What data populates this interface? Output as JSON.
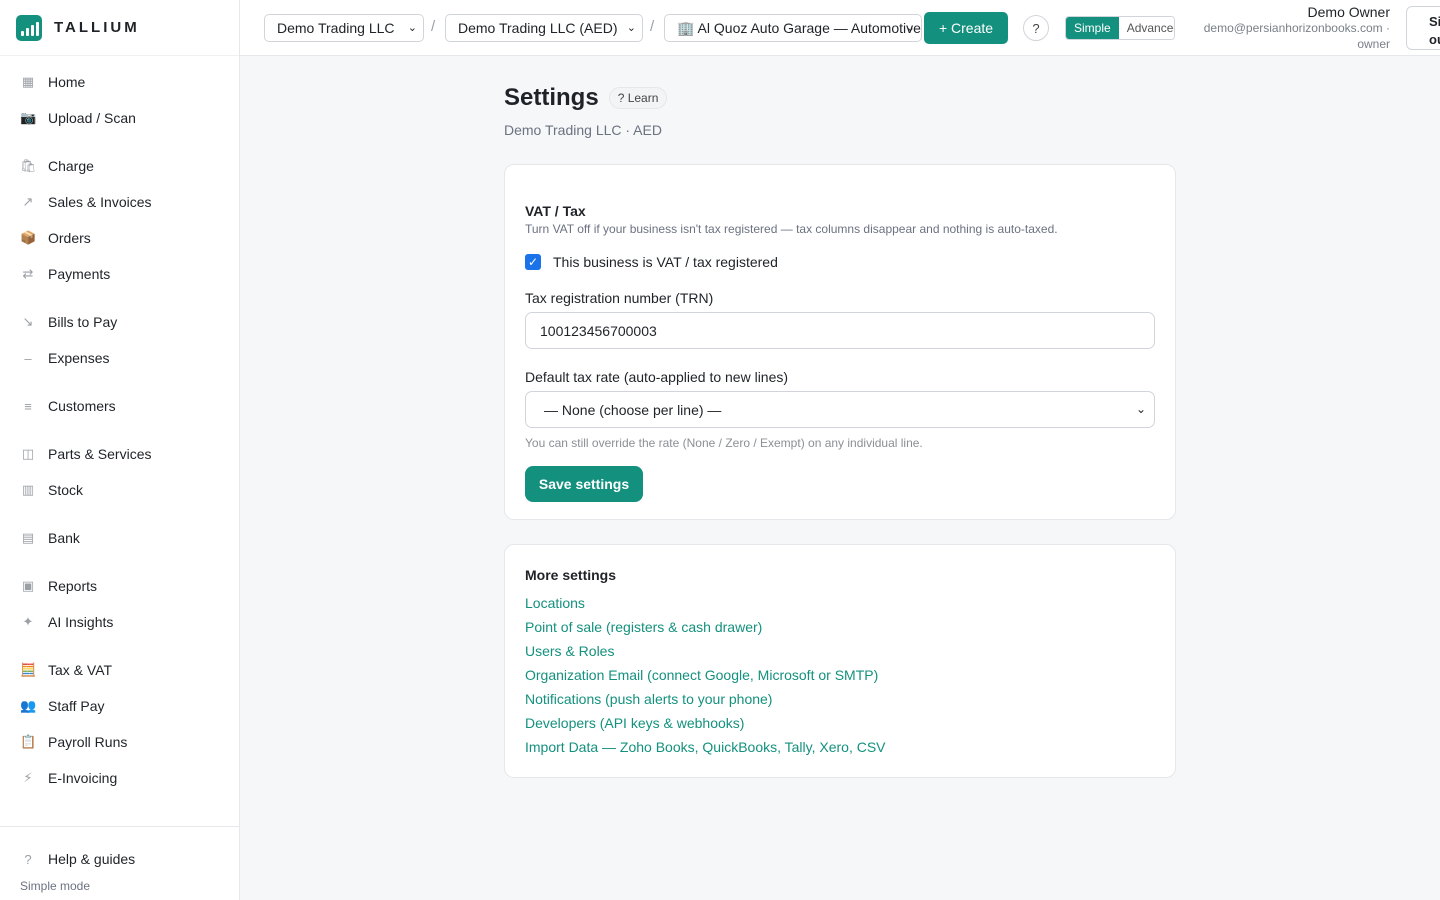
{
  "brand": {
    "name": "TALLIUM",
    "accent": "#14917e"
  },
  "sidebar": {
    "items": [
      {
        "label": "Home",
        "icon": "grid-icon",
        "glyph": "▦"
      },
      {
        "label": "Upload / Scan",
        "icon": "camera-icon",
        "glyph": "📷"
      },
      {
        "label": "Charge",
        "icon": "shopping-bag-icon",
        "glyph": "🛍"
      },
      {
        "label": "Sales & Invoices",
        "icon": "arrow-up-right-icon",
        "glyph": "↗"
      },
      {
        "label": "Orders",
        "icon": "package-icon",
        "glyph": "📦"
      },
      {
        "label": "Payments",
        "icon": "transfer-icon",
        "glyph": "⇄"
      },
      {
        "label": "Bills to Pay",
        "icon": "arrow-down-right-icon",
        "glyph": "↘"
      },
      {
        "label": "Expenses",
        "icon": "minus-icon",
        "glyph": "–"
      },
      {
        "label": "Customers",
        "icon": "list-icon",
        "glyph": "≡"
      },
      {
        "label": "Parts & Services",
        "icon": "box-icon",
        "glyph": "◫"
      },
      {
        "label": "Stock",
        "icon": "columns-icon",
        "glyph": "▥"
      },
      {
        "label": "Bank",
        "icon": "bank-icon",
        "glyph": "▤"
      },
      {
        "label": "Reports",
        "icon": "chart-icon",
        "glyph": "▣"
      },
      {
        "label": "AI Insights",
        "icon": "sparkle-icon",
        "glyph": "✦"
      },
      {
        "label": "Tax & VAT",
        "icon": "abacus-icon",
        "glyph": "🧮"
      },
      {
        "label": "Staff Pay",
        "icon": "people-icon",
        "glyph": "👥"
      },
      {
        "label": "Payroll Runs",
        "icon": "clipboard-icon",
        "glyph": "📋"
      },
      {
        "label": "E-Invoicing",
        "icon": "lightning-icon",
        "glyph": "⚡"
      }
    ],
    "help": {
      "label": "Help & guides",
      "glyph": "?"
    },
    "mode_label": "Simple mode"
  },
  "topbar": {
    "org_select": "Demo Trading LLC",
    "currency_select": "Demo Trading LLC (AED)",
    "location_select": "🏢 Al Quoz Auto Garage — Automotive",
    "create_label": "+ Create",
    "help_label": "?",
    "mode_simple": "Simple",
    "mode_advanced": "Advanced",
    "user_name": "Demo Owner",
    "user_email": "demo@persianhorizonbooks.com ·",
    "user_role": "owner",
    "signout_label": "Sign out"
  },
  "page": {
    "title": "Settings",
    "learn_label": "? Learn",
    "subtitle": "Demo Trading LLC · AED"
  },
  "vat": {
    "title": "VAT / Tax",
    "description": "Turn VAT off if your business isn't tax registered — tax columns disappear and nothing is auto-taxed.",
    "checkbox_label": "This business is VAT / tax registered",
    "trn_label": "Tax registration number (TRN)",
    "trn_value": "100123456700003",
    "rate_label": "Default tax rate (auto-applied to new lines)",
    "rate_value": "— None (choose per line) —",
    "hint": "You can still override the rate (None / Zero / Exempt) on any individual line.",
    "save_label": "Save settings"
  },
  "more": {
    "title": "More settings",
    "links": [
      "Locations",
      "Point of sale (registers & cash drawer)",
      "Users & Roles",
      "Organization Email (connect Google, Microsoft or SMTP)",
      "Notifications (push alerts to your phone)",
      "Developers (API keys & webhooks)",
      "Import Data — Zoho Books, QuickBooks, Tally, Xero, CSV"
    ]
  }
}
